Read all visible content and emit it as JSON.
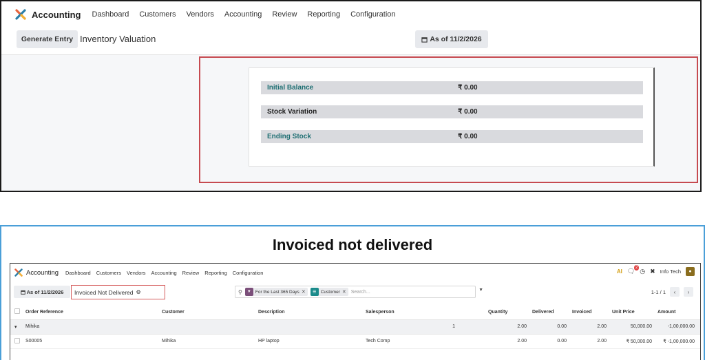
{
  "top": {
    "nav": {
      "app_title": "Accounting",
      "menu": [
        "Dashboard",
        "Customers",
        "Vendors",
        "Accounting",
        "Review",
        "Reporting",
        "Configuration"
      ]
    },
    "control": {
      "generate_label": "Generate Entry",
      "page_title": "Inventory Valuation",
      "as_of_label": "As of 11/2/2026"
    },
    "valuation": {
      "rows": [
        {
          "label": "Initial Balance",
          "amount": "₹ 0.00"
        },
        {
          "label": "Stock Variation",
          "amount": "₹ 0.00"
        },
        {
          "label": "Ending Stock",
          "amount": "₹ 0.00"
        }
      ]
    },
    "colors": {
      "highlight": "#c64a50",
      "teal_label": "#1f6f73"
    }
  },
  "bottom": {
    "heading": "Invoiced not delivered",
    "nav": {
      "app_title": "Accounting",
      "menu": [
        "Dashboard",
        "Customers",
        "Vendors",
        "Accounting",
        "Review",
        "Reporting",
        "Configuration"
      ],
      "ai_label": "AI",
      "notif_count": "2",
      "company": "Info Tech"
    },
    "control": {
      "as_of_label": "As of 11/2/2026",
      "filter_label": "Invoiced Not Delivered",
      "facets": [
        "For the Last 365 Days",
        "Customer"
      ],
      "search_placeholder": "Search...",
      "pager": "1-1 / 1"
    },
    "table": {
      "headers": [
        "Order Reference",
        "Customer",
        "Description",
        "Salesperson",
        "Quantity",
        "Delivered",
        "Invoiced",
        "Unit Price",
        "Amount"
      ],
      "group": {
        "name": "Mihika",
        "count": "1",
        "quantity": "2.00",
        "delivered": "0.00",
        "invoiced": "2.00",
        "unit_price": "50,000.00",
        "amount": "-1,00,000.00"
      },
      "rows": [
        {
          "order_ref": "S00005",
          "customer": "Mihika",
          "description": "HP laptop",
          "salesperson": "Tech Comp",
          "quantity": "2.00",
          "delivered": "0.00",
          "invoiced": "2.00",
          "unit_price": "₹ 50,000.00",
          "amount": "₹ -1,00,000.00"
        }
      ]
    },
    "colors": {
      "frame_border": "#4a9fd8",
      "filter_highlight": "#d45a5a",
      "facet_date": "#7b4f7a",
      "facet_customer": "#1a8a8a"
    }
  }
}
